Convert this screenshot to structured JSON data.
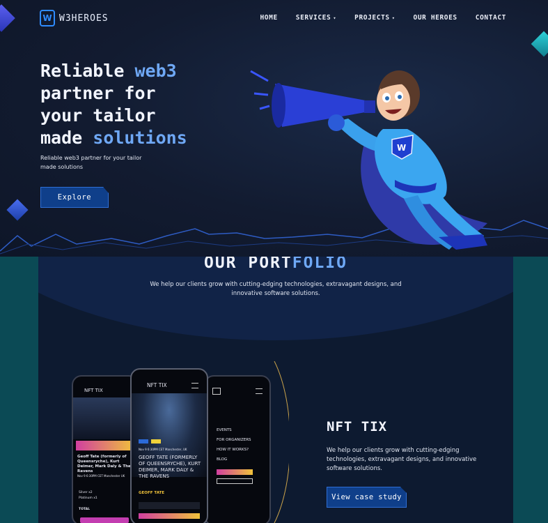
{
  "brand": {
    "name": "W3HEROES",
    "accent": "#2f8cff"
  },
  "nav": {
    "items": [
      {
        "label": "HOME",
        "has_dropdown": false
      },
      {
        "label": "SERVICES",
        "has_dropdown": true
      },
      {
        "label": "PROJECTS",
        "has_dropdown": true
      },
      {
        "label": "OUR HEROES",
        "has_dropdown": false
      },
      {
        "label": "CONTACT",
        "has_dropdown": false
      }
    ]
  },
  "hero": {
    "headline_1": "Reliable ",
    "headline_1_hl": "web3",
    "headline_2": "partner for",
    "headline_3": "your tailor",
    "headline_4": "made ",
    "headline_4_hl": "solutions",
    "subtext": "Reliable web3 partner for your tailor made solutions",
    "cta_label": "Explore"
  },
  "portfolio": {
    "title_a": "OUR PORT",
    "title_b": "FOLIO",
    "subtitle": "We help our clients grow with cutting-edging technologies, extravagant designs, and innovative software solutions.",
    "case": {
      "title": "NFT TIX",
      "description": "We help our clients grow with cutting-edging technologies, extravagant designs, and innovative software solutions.",
      "cta_label": "View case study"
    },
    "phone_left": {
      "brand": "NFT TIX",
      "event_title": "Geoff Tate (formerly of Queensryche), Kurt Deimer, Mark Daly & The Ravens",
      "date": "Nov 9  6:30PM CET  Manchester UK",
      "row1_label": "Silver x2",
      "row2_label": "Platinum x1",
      "total_label": "TOTAL"
    },
    "phone_mid": {
      "brand": "NFT TIX",
      "date": "Nov 9  6:30PM CET  Manchester, UK",
      "title": "GEOFF TATE (FORMERLY OF QUEENSRYCHE), KURT DEIMER, MARK DALY & THE RAVENS",
      "tag": "GEOFF TATE"
    },
    "phone_right": {
      "menu": [
        "EVENTS",
        "FOR ORGANIZERS",
        "HOW IT WORKS?",
        "BLOG"
      ]
    }
  }
}
